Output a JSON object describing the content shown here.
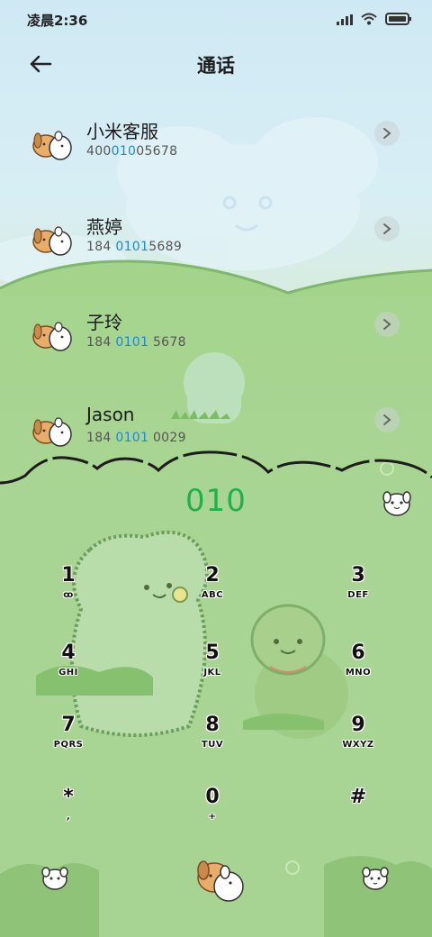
{
  "status_bar": {
    "time": "凌晨2:36",
    "icons": [
      "signal-icon",
      "wifi-icon",
      "battery-icon"
    ]
  },
  "header": {
    "title": "通话",
    "back_icon": "back-arrow-icon"
  },
  "contacts": [
    {
      "name": "小米客服",
      "number_pre": "400",
      "number_match": "010",
      "number_post": "05678"
    },
    {
      "name": "燕婷",
      "number_pre": "184 ",
      "number_match": "0101",
      "number_post": "5689"
    },
    {
      "name": "子玲",
      "number_pre": "184 ",
      "number_match": "0101",
      "number_post": " 5678"
    },
    {
      "name": "Jason",
      "number_pre": "184 ",
      "number_match": "0101",
      "number_post": " 0029"
    }
  ],
  "dialpad": {
    "number": "010",
    "keys": [
      {
        "digit": "1",
        "letters": "ꝏ"
      },
      {
        "digit": "2",
        "letters": "ABC"
      },
      {
        "digit": "3",
        "letters": "DEF"
      },
      {
        "digit": "4",
        "letters": "GHI"
      },
      {
        "digit": "5",
        "letters": "JKL"
      },
      {
        "digit": "6",
        "letters": "MNO"
      },
      {
        "digit": "7",
        "letters": "PQRS"
      },
      {
        "digit": "8",
        "letters": "TUV"
      },
      {
        "digit": "9",
        "letters": "WXYZ"
      },
      {
        "digit": "*",
        "letters": ","
      },
      {
        "digit": "0",
        "letters": "+"
      },
      {
        "digit": "#",
        "letters": ""
      }
    ]
  },
  "colors": {
    "accent_green": "#1fb14a",
    "match_blue": "#1e87d6",
    "grass": "#a9d594",
    "sky": "#cfe9f4"
  }
}
